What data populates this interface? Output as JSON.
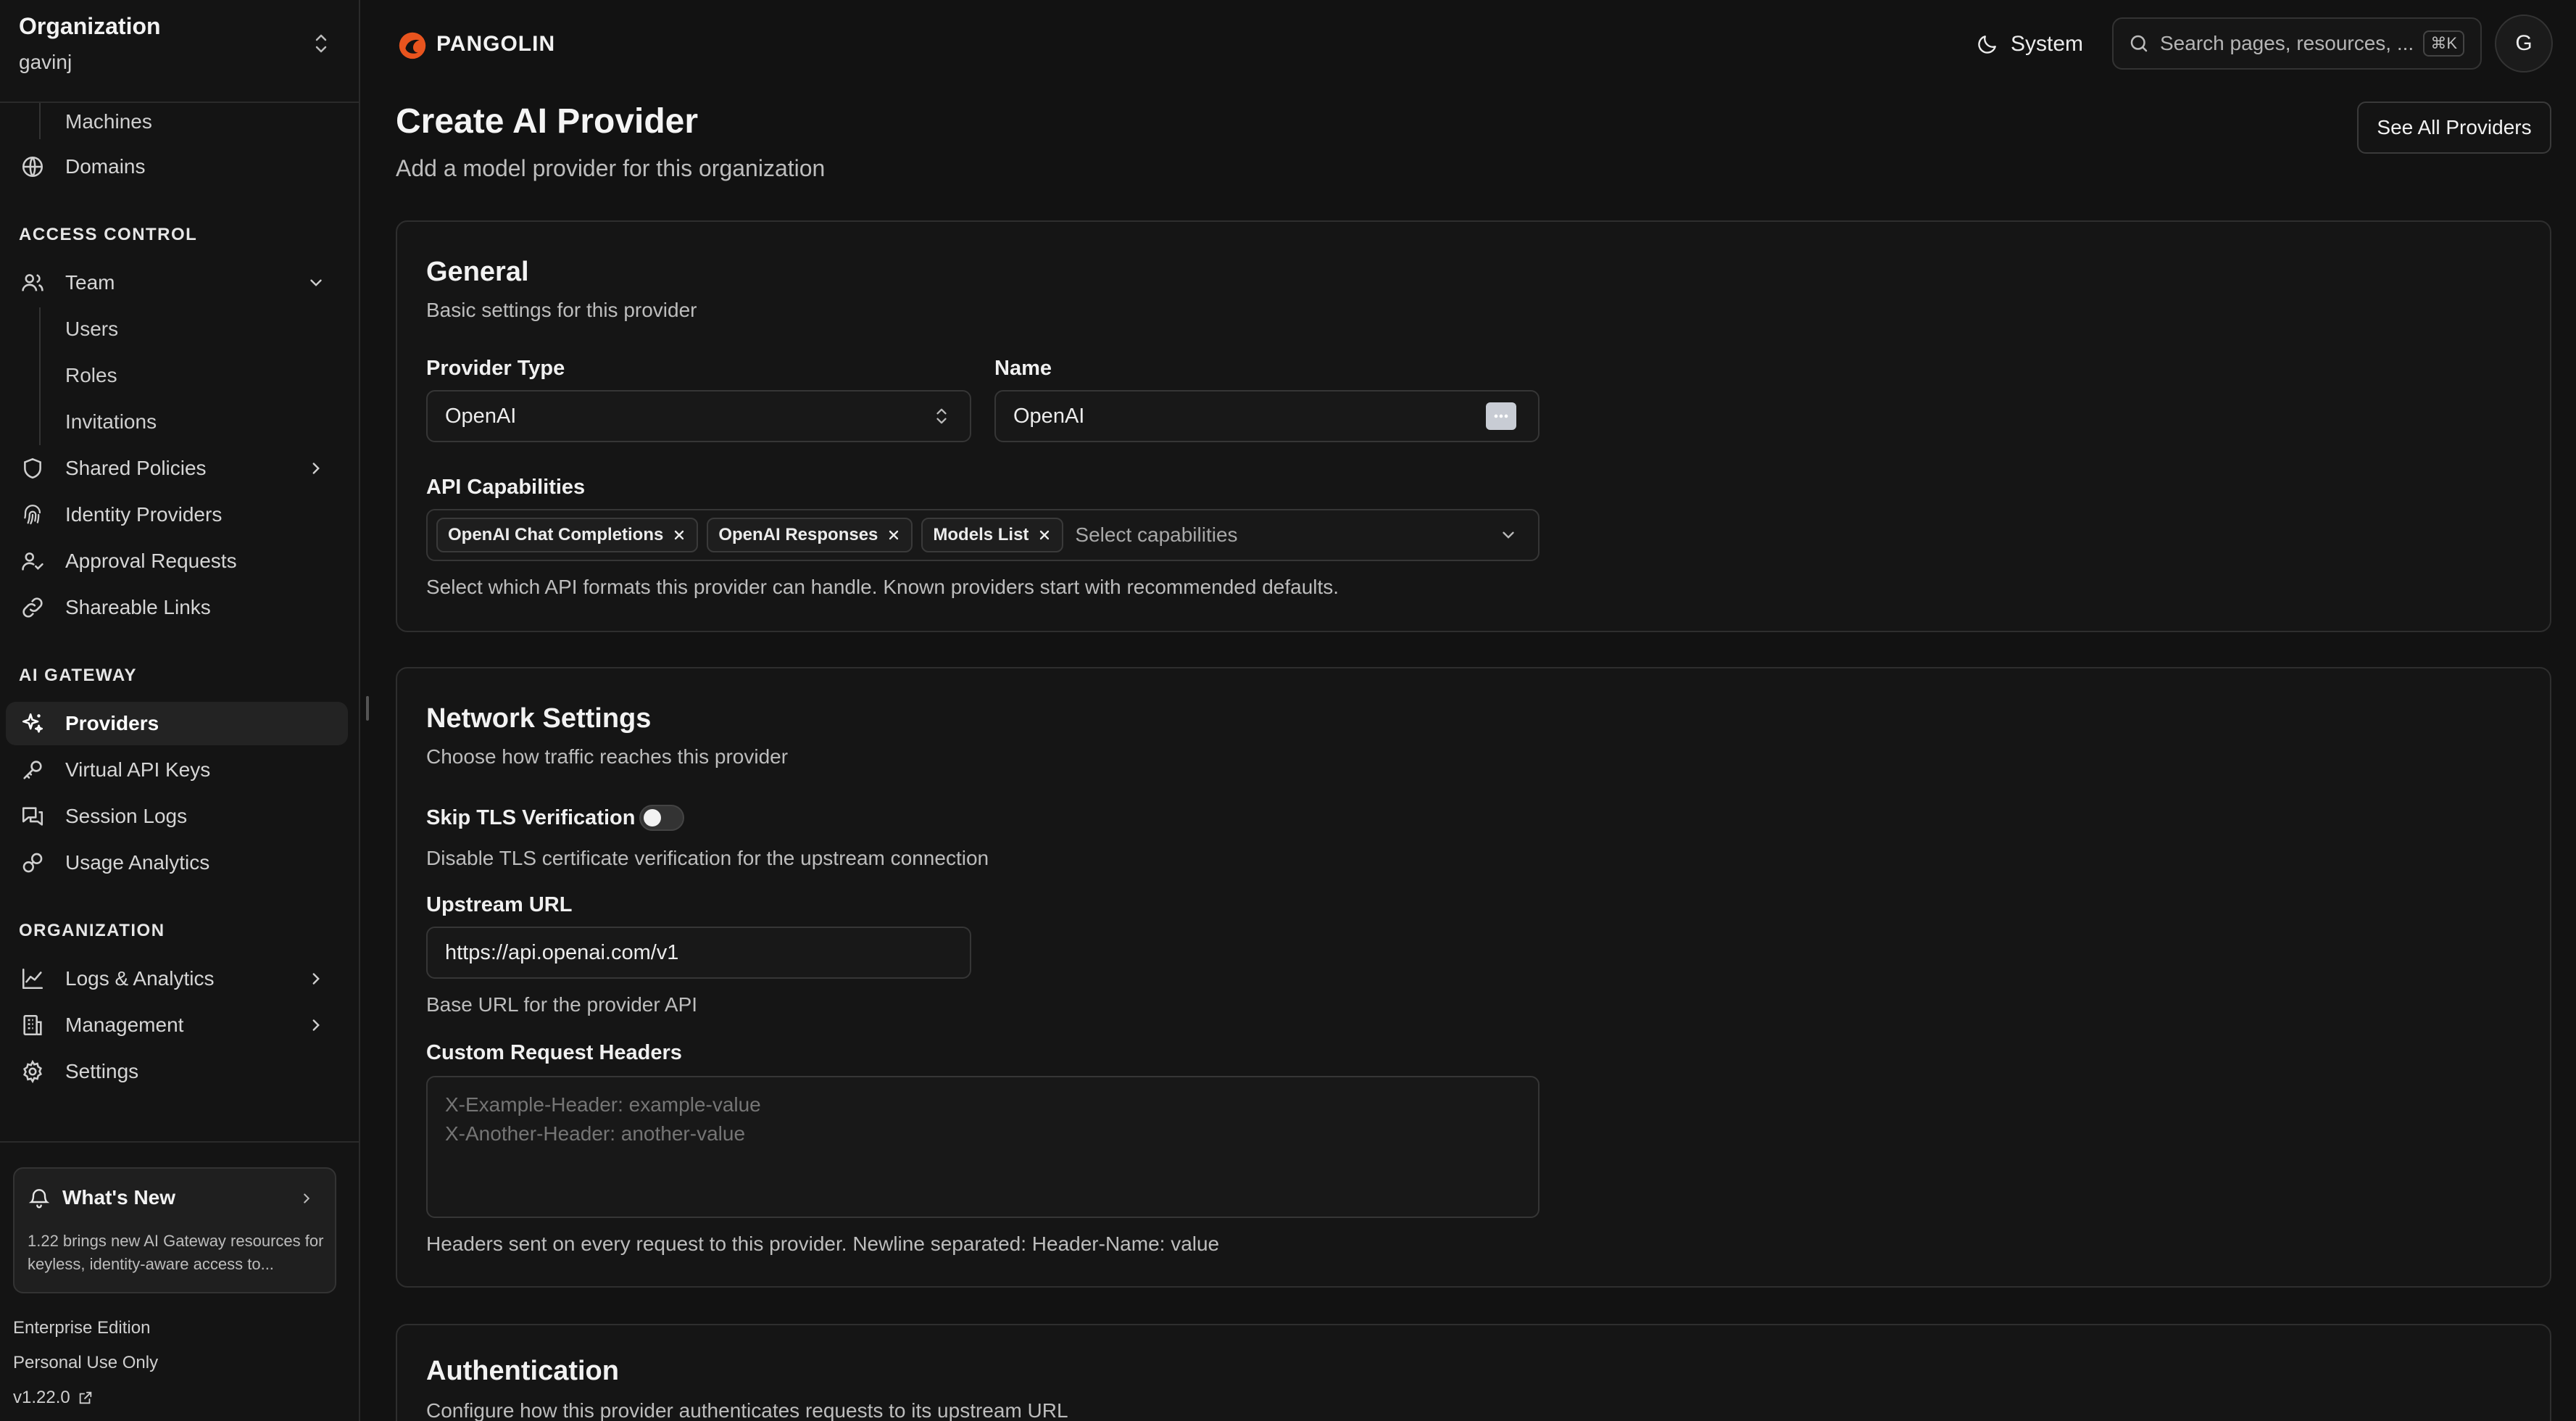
{
  "sidebar": {
    "org_title": "Organization",
    "org_name": "gavinj",
    "items": {
      "machines": "Machines",
      "domains": "Domains",
      "team": "Team",
      "users": "Users",
      "roles": "Roles",
      "invitations": "Invitations",
      "shared_policies": "Shared Policies",
      "identity_providers": "Identity Providers",
      "approval_requests": "Approval Requests",
      "shareable_links": "Shareable Links",
      "providers": "Providers",
      "virtual_api_keys": "Virtual API Keys",
      "session_logs": "Session Logs",
      "usage_analytics": "Usage Analytics",
      "logs_analytics": "Logs & Analytics",
      "management": "Management",
      "settings": "Settings"
    },
    "sections": {
      "access_control": "ACCESS CONTROL",
      "ai_gateway": "AI GATEWAY",
      "organization": "ORGANIZATION"
    },
    "whats_new": {
      "title": "What's New",
      "body": "1.22 brings new AI Gateway resources for keyless, identity-aware access to..."
    },
    "edition": "Enterprise Edition",
    "license": "Personal Use Only",
    "version": "v1.22.0"
  },
  "topbar": {
    "brand": "PANGOLIN",
    "theme_label": "System",
    "search_placeholder": "Search pages, resources, ...",
    "search_shortcut": "⌘K",
    "avatar_initial": "G"
  },
  "main": {
    "title": "Create AI Provider",
    "subtitle": "Add a model provider for this organization",
    "see_all_button": "See All Providers",
    "general": {
      "title": "General",
      "description": "Basic settings for this provider",
      "provider_type_label": "Provider Type",
      "provider_type_value": "OpenAI",
      "name_label": "Name",
      "name_value": "OpenAI",
      "capabilities_label": "API Capabilities",
      "capabilities": [
        "OpenAI Chat Completions",
        "OpenAI Responses",
        "Models List"
      ],
      "capabilities_placeholder": "Select capabilities",
      "capabilities_help": "Select which API formats this provider can handle. Known providers start with recommended defaults."
    },
    "network": {
      "title": "Network Settings",
      "description": "Choose how traffic reaches this provider",
      "skip_tls_label": "Skip TLS Verification",
      "skip_tls_help": "Disable TLS certificate verification for the upstream connection",
      "upstream_label": "Upstream URL",
      "upstream_value": "https://api.openai.com/v1",
      "upstream_help": "Base URL for the provider API",
      "headers_label": "Custom Request Headers",
      "headers_placeholder": "X-Example-Header: example-value\nX-Another-Header: another-value",
      "headers_help": "Headers sent on every request to this provider. Newline separated: Header-Name: value"
    },
    "auth": {
      "title": "Authentication",
      "description": "Configure how this provider authenticates requests to its upstream URL"
    }
  },
  "colors": {
    "background": "#121212",
    "card": "#151515",
    "brand": "#e8541e"
  }
}
